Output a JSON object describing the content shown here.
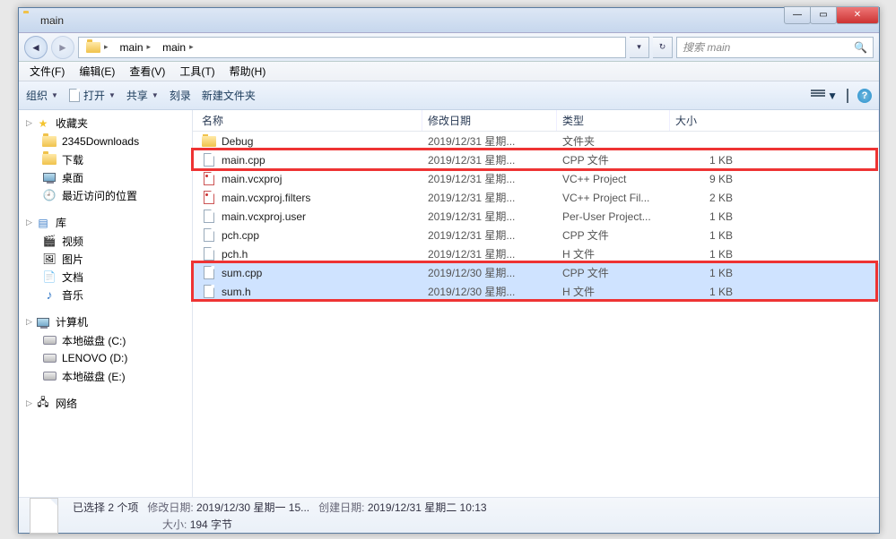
{
  "title": "main",
  "breadcrumb": {
    "items": [
      "main",
      "main"
    ]
  },
  "search": {
    "placeholder": "搜索 main"
  },
  "menubar": [
    "文件(F)",
    "编辑(E)",
    "查看(V)",
    "工具(T)",
    "帮助(H)"
  ],
  "toolbar": {
    "organize": "组织",
    "open": "打开",
    "share": "共享",
    "burn": "刻录",
    "newfolder": "新建文件夹"
  },
  "columns": {
    "name": "名称",
    "date": "修改日期",
    "type": "类型",
    "size": "大小"
  },
  "sidebar": {
    "fav": {
      "label": "收藏夹",
      "items": [
        "2345Downloads",
        "下载",
        "桌面",
        "最近访问的位置"
      ]
    },
    "lib": {
      "label": "库",
      "items": [
        "视频",
        "图片",
        "文档",
        "音乐"
      ]
    },
    "pc": {
      "label": "计算机",
      "items": [
        "本地磁盘 (C:)",
        "LENOVO (D:)",
        "本地磁盘 (E:)"
      ]
    },
    "net": {
      "label": "网络"
    }
  },
  "files": [
    {
      "name": "Debug",
      "date": "2019/12/31 星期...",
      "type": "文件夹",
      "size": "",
      "icon": "folder"
    },
    {
      "name": "main.cpp",
      "date": "2019/12/31 星期...",
      "type": "CPP 文件",
      "size": "1 KB",
      "icon": "file"
    },
    {
      "name": "main.vcxproj",
      "date": "2019/12/31 星期...",
      "type": "VC++ Project",
      "size": "9 KB",
      "icon": "file-red"
    },
    {
      "name": "main.vcxproj.filters",
      "date": "2019/12/31 星期...",
      "type": "VC++ Project Fil...",
      "size": "2 KB",
      "icon": "file-red"
    },
    {
      "name": "main.vcxproj.user",
      "date": "2019/12/31 星期...",
      "type": "Per-User Project...",
      "size": "1 KB",
      "icon": "file"
    },
    {
      "name": "pch.cpp",
      "date": "2019/12/31 星期...",
      "type": "CPP 文件",
      "size": "1 KB",
      "icon": "file"
    },
    {
      "name": "pch.h",
      "date": "2019/12/31 星期...",
      "type": "H 文件",
      "size": "1 KB",
      "icon": "file"
    },
    {
      "name": "sum.cpp",
      "date": "2019/12/30 星期...",
      "type": "CPP 文件",
      "size": "1 KB",
      "icon": "file",
      "selected": true
    },
    {
      "name": "sum.h",
      "date": "2019/12/30 星期...",
      "type": "H 文件",
      "size": "1 KB",
      "icon": "file",
      "selected": true
    }
  ],
  "status": {
    "selected": "已选择 2 个项",
    "mod_label": "修改日期:",
    "mod_value": "2019/12/30 星期一 15...",
    "create_label": "创建日期:",
    "create_value": "2019/12/31 星期二 10:13",
    "size_label": "大小:",
    "size_value": "194 字节"
  }
}
